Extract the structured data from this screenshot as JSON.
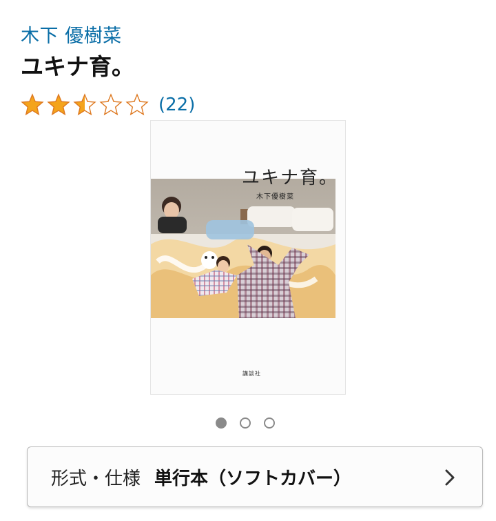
{
  "product": {
    "author": "木下 優樹菜",
    "title": "ユキナ育。",
    "rating": {
      "value": 2.5,
      "max": 5,
      "count_text": "(22)"
    }
  },
  "cover": {
    "title": "ユキナ育。",
    "author": "木下優樹菜",
    "publisher": "講談社"
  },
  "carousel": {
    "total": 3,
    "active_index": 0
  },
  "format": {
    "label": "形式・仕様",
    "value": "単行本（ソフトカバー）",
    "icon": "chevron-right-icon"
  },
  "colors": {
    "link": "#0a6ea7",
    "star": "#f4a41c",
    "star_outline": "#de7921"
  }
}
